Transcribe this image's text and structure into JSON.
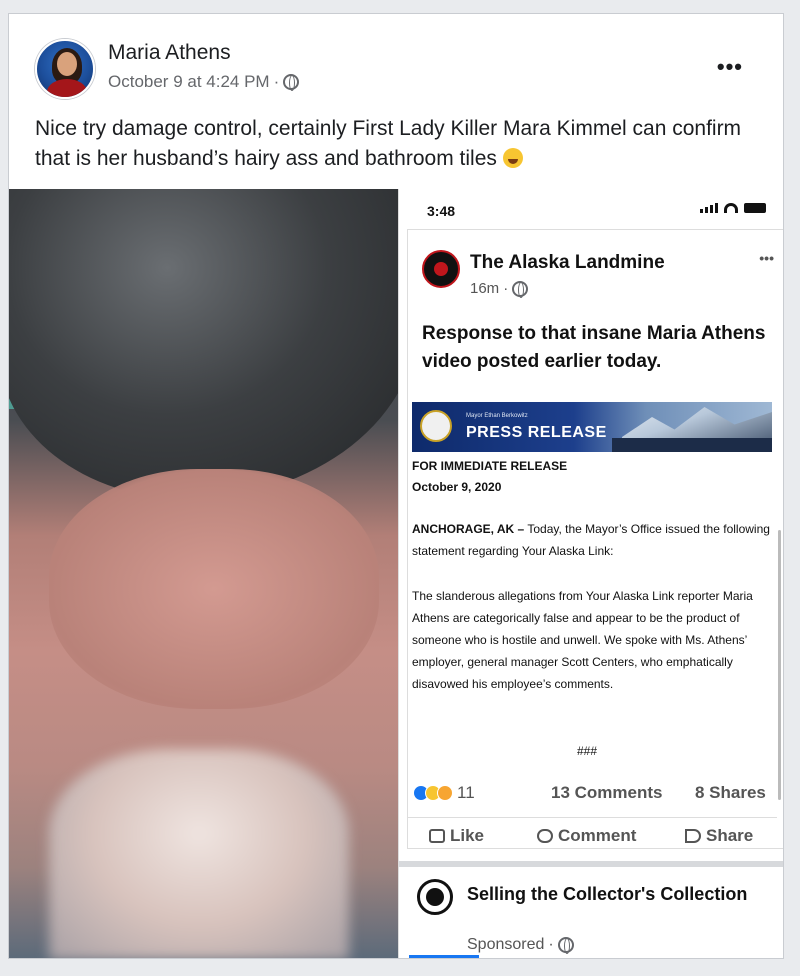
{
  "post": {
    "author": "Maria Athens",
    "timestamp": "October 9 at 4:24 PM",
    "separator": "·",
    "more": "•••",
    "caption": "Nice try damage control, certainly First Lady Killer Mara Kimmel can confirm that is her husband’s hairy ass and bathroom tiles"
  },
  "phone": {
    "time": "3:48",
    "shared_post": {
      "page_name": "The Alaska Landmine",
      "age": "16m",
      "separator": "·",
      "more": "•••",
      "text": "Response to that insane Maria Athens video posted earlier today.",
      "press": {
        "office": "Mayor Ethan Berkowitz",
        "title": "PRESS RELEASE"
      },
      "doc": {
        "heading": "FOR IMMEDIATE RELEASE",
        "date": "October 9, 2020",
        "dateline": "ANCHORAGE, AK –",
        "p1": " Today, the Mayor’s Office issued the following statement regarding Your Alaska Link:",
        "p2": "The slanderous allegations from Your Alaska Link reporter Maria Athens are categorically false and appear to be the product of someone who is hostile and unwell. We spoke with Ms. Athens’ employer, general manager Scott Centers, who emphatically disavowed his employee’s comments.",
        "end": "###"
      },
      "counts": {
        "reactions": "11",
        "comments": "13 Comments",
        "shares": "8 Shares"
      },
      "actions": {
        "like": "Like",
        "comment": "Comment",
        "share": "Share"
      }
    },
    "ad": {
      "name": "Selling the Collector's Collection",
      "label": "Sponsored",
      "separator": "·"
    }
  }
}
